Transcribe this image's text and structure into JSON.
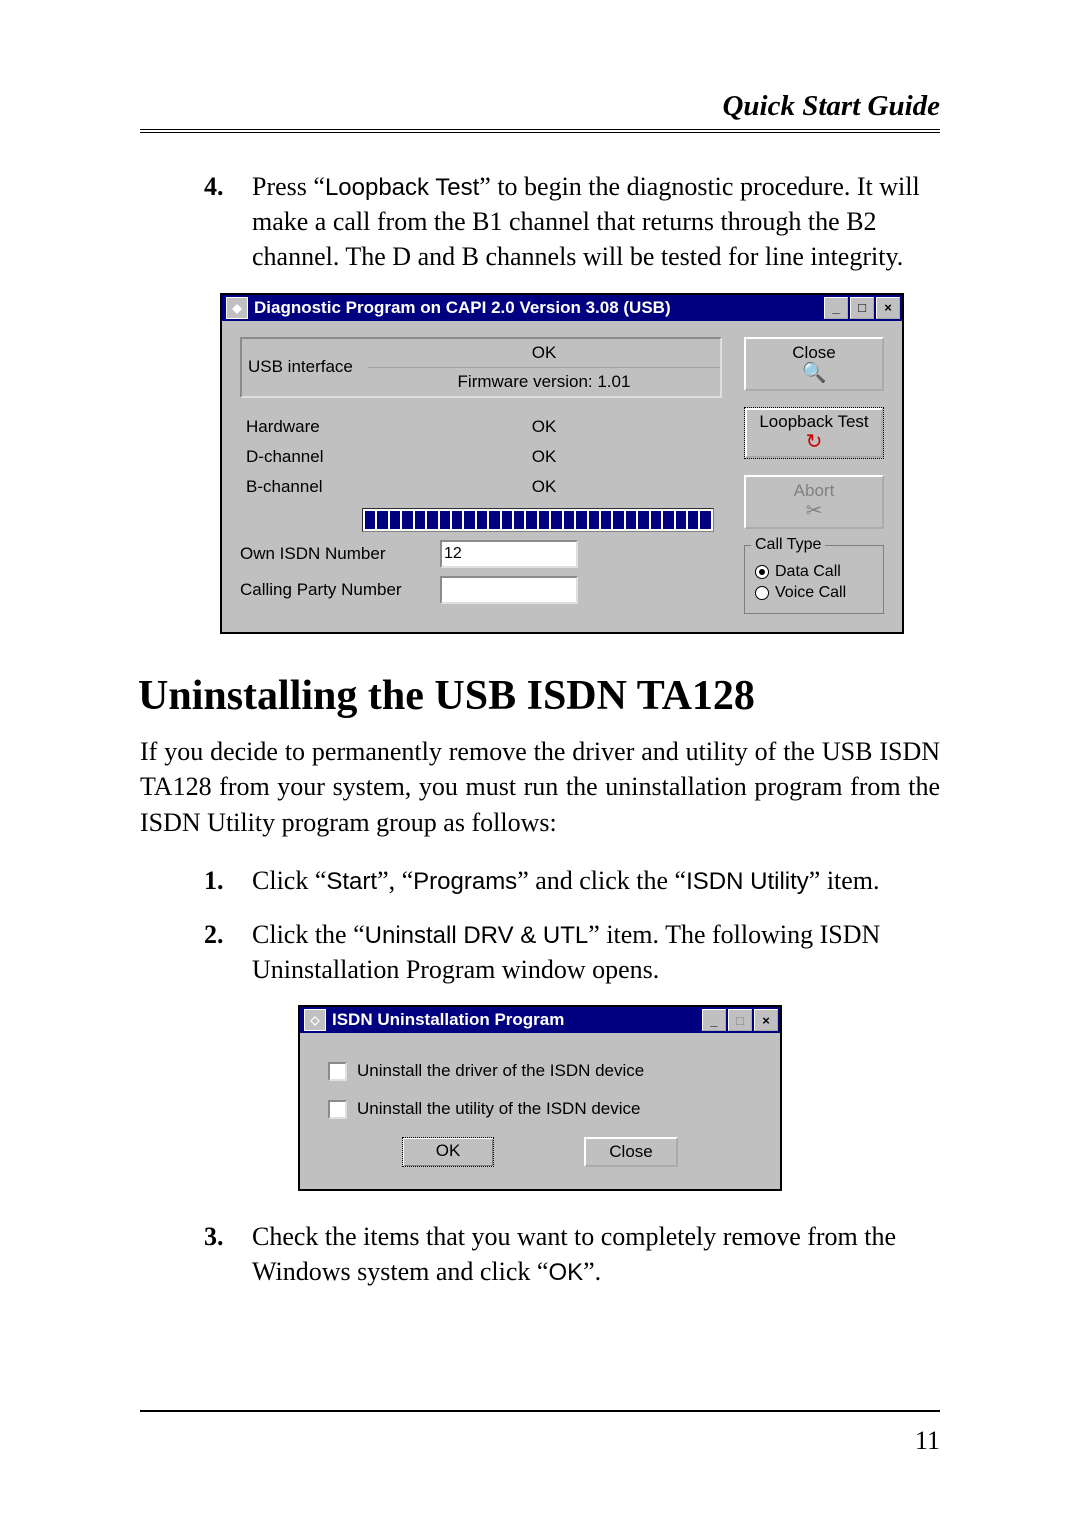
{
  "header": "Quick Start Guide",
  "step4": {
    "num": "4.",
    "pre": "Press “",
    "btn": "Loopback Test",
    "post": "” to begin the diagnostic procedure.  It will make a call from the B1 channel that returns through the B2 channel.  The D and B channels will be tested for line integrity."
  },
  "diag": {
    "title": "Diagnostic Program on CAPI 2.0 Version 3.08 (USB)",
    "usb_label": "USB interface",
    "usb_ok": "OK",
    "fw": "Firmware version: 1.01",
    "rows": [
      {
        "label": "Hardware",
        "value": "OK"
      },
      {
        "label": "D-channel",
        "value": "OK"
      },
      {
        "label": "B-channel",
        "value": "OK"
      }
    ],
    "own_label": "Own ISDN Number",
    "own_value": "12",
    "calling_label": "Calling Party Number",
    "calling_value": "",
    "btn_close": "Close",
    "btn_loopback": "Loopback Test",
    "btn_abort": "Abort",
    "calltype_legend": "Call Type",
    "radio_data": "Data Call",
    "radio_voice": "Voice Call"
  },
  "section_title": "Uninstalling the USB ISDN TA128",
  "para1": "If you decide to permanently remove the driver and utility of the USB ISDN TA128 from your system, you must run the uninstallation program from the ISDN Utility program group as follows:",
  "step1": {
    "num": "1.",
    "t1": "Click “",
    "start": "Start",
    "t2": "”, “",
    "programs": "Programs",
    "t3": "” and click the “",
    "isdn": "ISDN Utility",
    "t4": "” item."
  },
  "step2": {
    "num": "2.",
    "t1": "Click the “",
    "uninstall": "Uninstall DRV & UTL",
    "t2": "” item.  The following ISDN Uninstallation Program window opens."
  },
  "uninst": {
    "title": "ISDN Uninstallation Program",
    "chk1": "Uninstall the driver of the ISDN device",
    "chk2": "Uninstall the utility of the ISDN device",
    "ok": "OK",
    "close": "Close"
  },
  "step3": {
    "num": "3.",
    "t1": "Check the items that you want to completely remove from the Windows system and click “",
    "ok": "OK",
    "t2": "”."
  },
  "pagenum": "11"
}
